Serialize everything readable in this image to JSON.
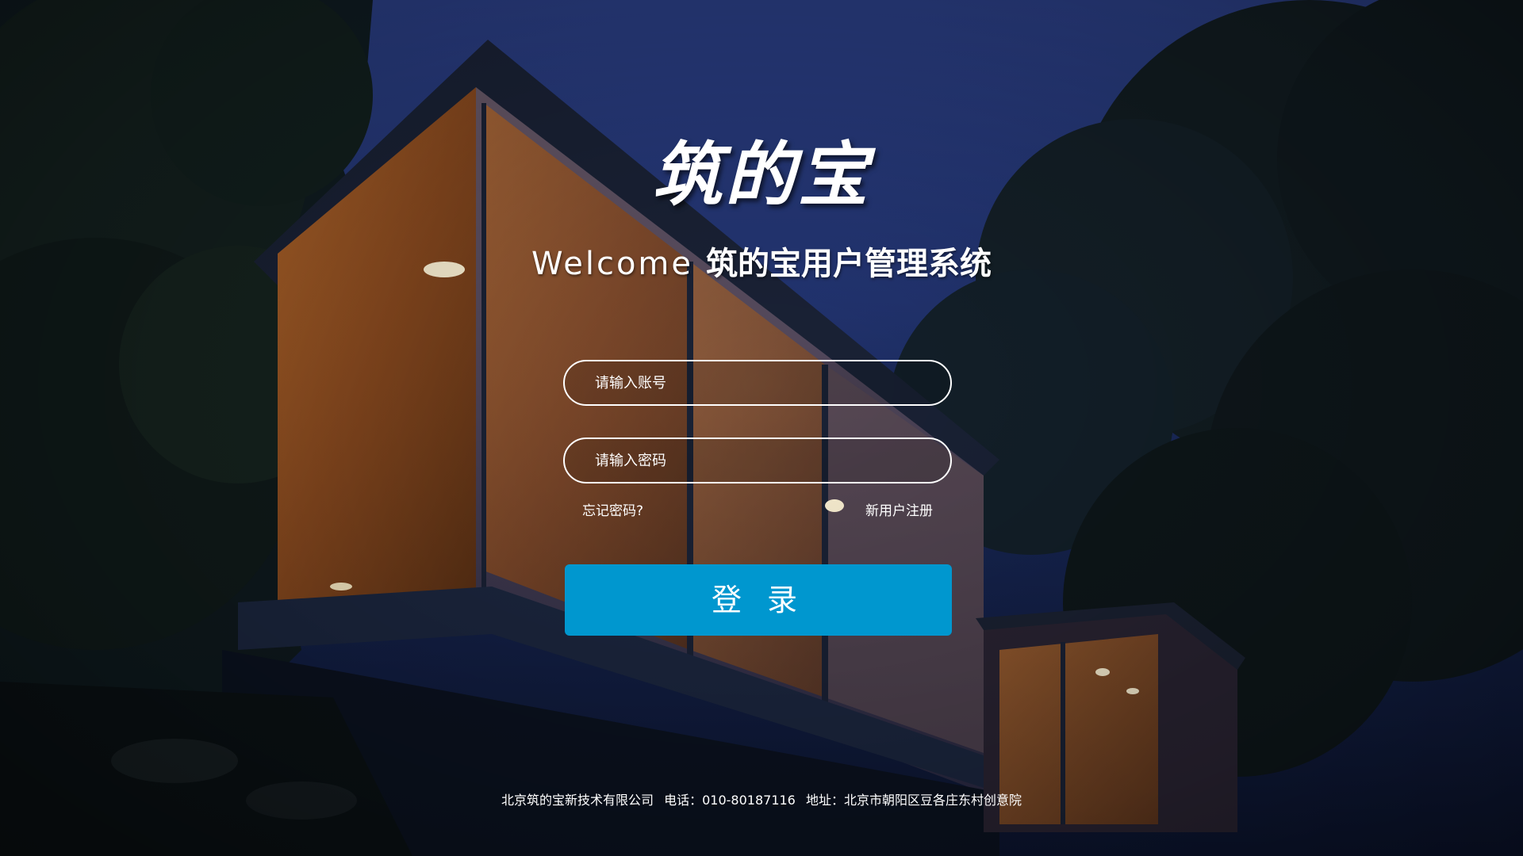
{
  "brand": {
    "logo_text": "筑的宝",
    "welcome_en": "Welcome",
    "welcome_cn": "筑的宝用户管理系统"
  },
  "form": {
    "account_placeholder": "请输入账号",
    "account_value": "",
    "password_placeholder": "请输入密码",
    "password_value": "",
    "forgot_label": "忘记密码?",
    "register_label": "新用户注册",
    "login_label": "登 录"
  },
  "footer": {
    "company": "北京筑的宝新技术有限公司",
    "phone": "电话：010-80187116",
    "address": "地址：北京市朝阳区豆各庄东村创意院"
  },
  "colors": {
    "login_button": "#0097cf",
    "sky": "#2b3f86",
    "text": "#ffffff"
  }
}
